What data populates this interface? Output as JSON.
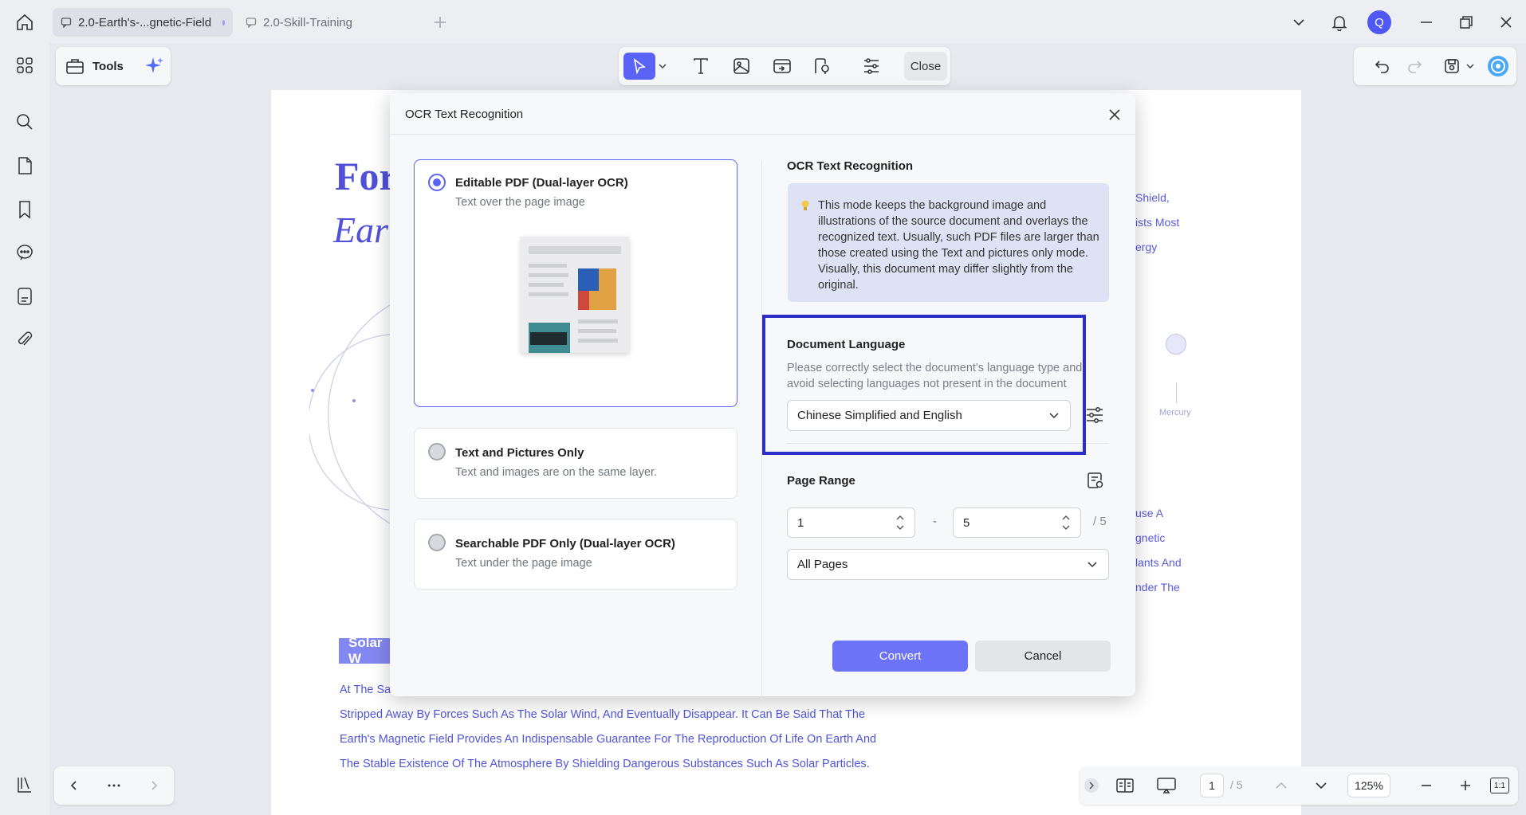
{
  "tabs": [
    {
      "label": "2.0-Earth's-...gnetic-Field",
      "active": true
    },
    {
      "label": "2.0-Skill-Training",
      "active": false
    }
  ],
  "user": {
    "avatar_letter": "Q"
  },
  "tools": {
    "label": "Tools"
  },
  "toolbar": {
    "close_label": "Close"
  },
  "document": {
    "title_line1": "For",
    "title_line2": "Ear",
    "right_text": [
      "Shield,",
      "ists Most",
      "ergy"
    ],
    "planet_label": "Mercury",
    "right_text2": [
      "use A",
      "gnetic",
      "lants And",
      "nder The"
    ],
    "solar_tag": "Solar W",
    "paragraph": [
      "At The Sa",
      "Stripped Away By Forces Such As The Solar Wind, And Eventually Disappear. It Can Be Said That The",
      "Earth's Magnetic Field Provides An Indispensable Guarantee For The Reproduction Of Life On Earth And",
      "The Stable Existence Of The Atmosphere By Shielding Dangerous Substances Such As Solar Particles."
    ]
  },
  "modal": {
    "title": "OCR Text Recognition",
    "options": [
      {
        "title": "Editable PDF (Dual-layer OCR)",
        "subtitle": "Text over the page image",
        "selected": true
      },
      {
        "title": "Text and Pictures Only",
        "subtitle": "Text and images are on the same layer.",
        "selected": false
      },
      {
        "title": "Searchable PDF Only (Dual-layer OCR)",
        "subtitle": "Text under the page image",
        "selected": false
      }
    ],
    "right_title": "OCR Text Recognition",
    "info_text": "This mode keeps the background image and illustrations of the source document and overlays the recognized text. Usually, such PDF files are larger than those created using the Text and pictures only mode. Visually, this document may differ slightly from the original.",
    "language": {
      "title": "Document Language",
      "description": "Please correctly select the document's language type and avoid selecting languages not present in the document",
      "selected": "Chinese Simplified and English"
    },
    "page_range": {
      "title": "Page Range",
      "from": "1",
      "to": "5",
      "total": "/ 5",
      "dash": "-",
      "selection": "All Pages"
    },
    "convert_label": "Convert",
    "cancel_label": "Cancel"
  },
  "status": {
    "page_current": "1",
    "page_total": "/ 5",
    "zoom": "125%",
    "fit_label": "1:1"
  },
  "colors": {
    "accent": "#5b63f6",
    "highlight": "#2d2fc4",
    "doc_text": "#4f54d9"
  }
}
